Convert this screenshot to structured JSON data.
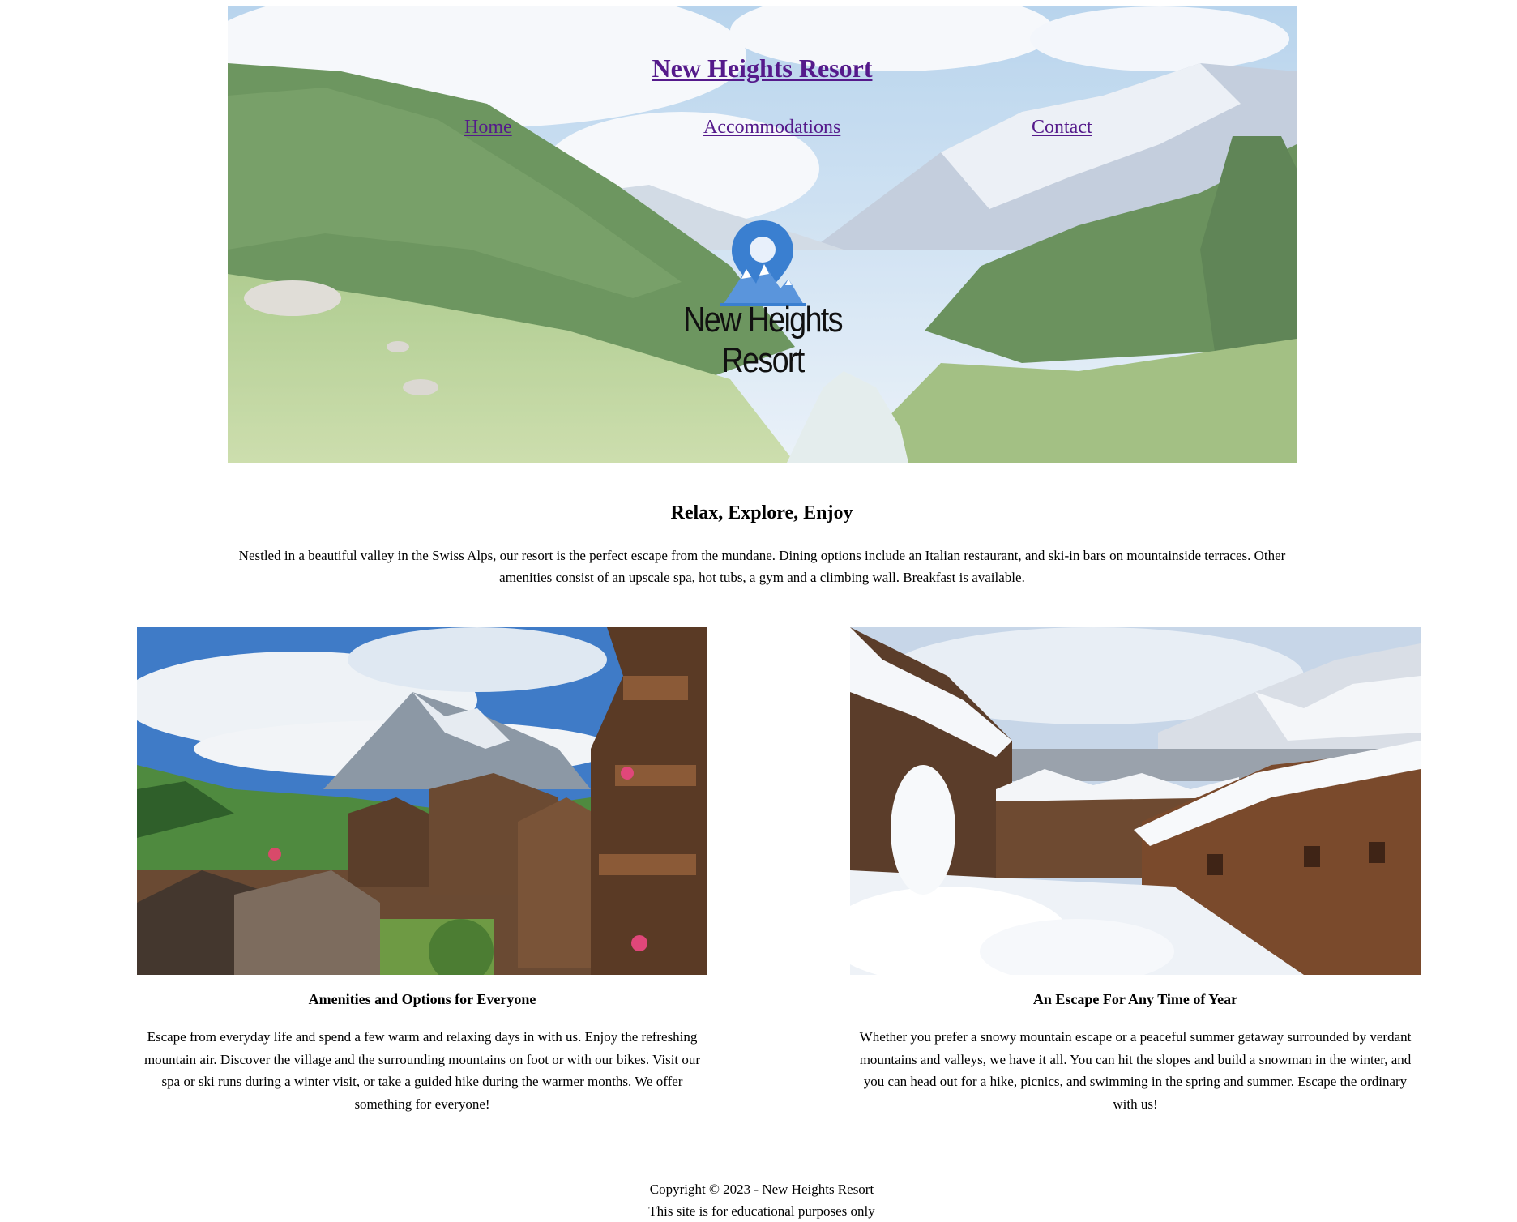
{
  "header": {
    "site_title": "New Heights Resort",
    "nav": {
      "home": "Home",
      "accommodations": "Accommodations",
      "contact": "Contact"
    },
    "logo_text": "New Heights Resort"
  },
  "intro": {
    "title": "Relax, Explore, Enjoy",
    "text": "Nestled in a beautiful valley in the Swiss Alps, our resort is the perfect escape from the mundane. Dining options include an Italian restaurant, and ski-in bars on mountainside terraces. Other amenities consist of an upscale spa, hot tubs, a gym and a climbing wall. Breakfast is available."
  },
  "cards": [
    {
      "title": "Amenities and Options for Everyone",
      "text": "Escape from everyday life and spend a few warm and relaxing days in with us. Enjoy the refreshing mountain air. Discover the village and the surrounding mountains on foot or with our bikes. Visit our spa or ski runs during a winter visit, or take a guided hike during the warmer months. We offer something for everyone!"
    },
    {
      "title": "An Escape For Any Time of Year",
      "text": "Whether you prefer a snowy mountain escape or a peaceful summer getaway surrounded by verdant mountains and valleys, we have it all. You can hit the slopes and build a snowman in the winter, and you can head out for a hike, picnics, and swimming in the spring and summer. Escape the ordinary with us!"
    }
  ],
  "footer": {
    "copyright": "Copyright © 2023 - New Heights Resort",
    "note": "This site is for educational purposes only"
  },
  "colors": {
    "link": "#551a8b",
    "logo_pin": "#3a7fd0",
    "text": "#000000"
  }
}
